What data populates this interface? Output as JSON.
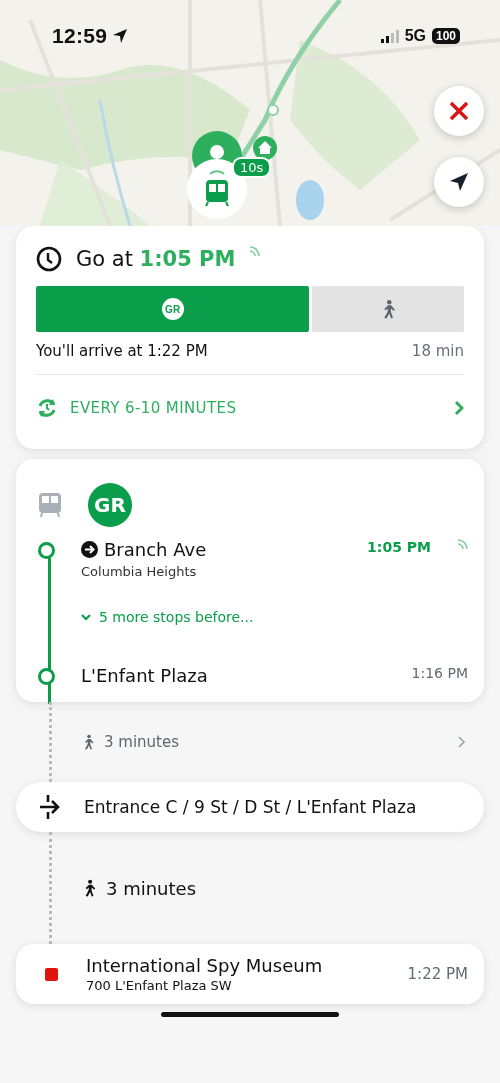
{
  "status_bar": {
    "time": "12:59",
    "network": "5G",
    "battery": "100"
  },
  "map": {
    "eta_badge": "10s"
  },
  "departure": {
    "prefix": "Go at ",
    "time": "1:05 PM",
    "realtime": true,
    "mode_tabs": [
      {
        "kind": "line",
        "label": "GR",
        "selected": true
      },
      {
        "kind": "walk",
        "selected": false
      }
    ],
    "arrival": "You'll arrive at 1:22 PM",
    "duration": "18 min",
    "frequency": "EVERY 6-10 MINUTES"
  },
  "leg": {
    "line": "GR",
    "more_stops": "5 more stops before...",
    "stops": [
      {
        "kind": "board",
        "name": "Branch Ave",
        "area": "Columbia Heights",
        "time": "1:05 PM",
        "realtime": true
      },
      {
        "kind": "alight",
        "name": "L'Enfant Plaza",
        "time": "1:16 PM"
      }
    ]
  },
  "steps": [
    {
      "kind": "walk",
      "text": "3 minutes",
      "expandable": true
    },
    {
      "kind": "entrance",
      "text": "Entrance C / 9 St / D St / L'Enfant Plaza"
    },
    {
      "kind": "walk",
      "text": "3 minutes",
      "expandable": false
    },
    {
      "kind": "destination",
      "name": "International Spy Museum",
      "address": "700 L'Enfant Plaza SW",
      "time": "1:22 PM"
    }
  ]
}
